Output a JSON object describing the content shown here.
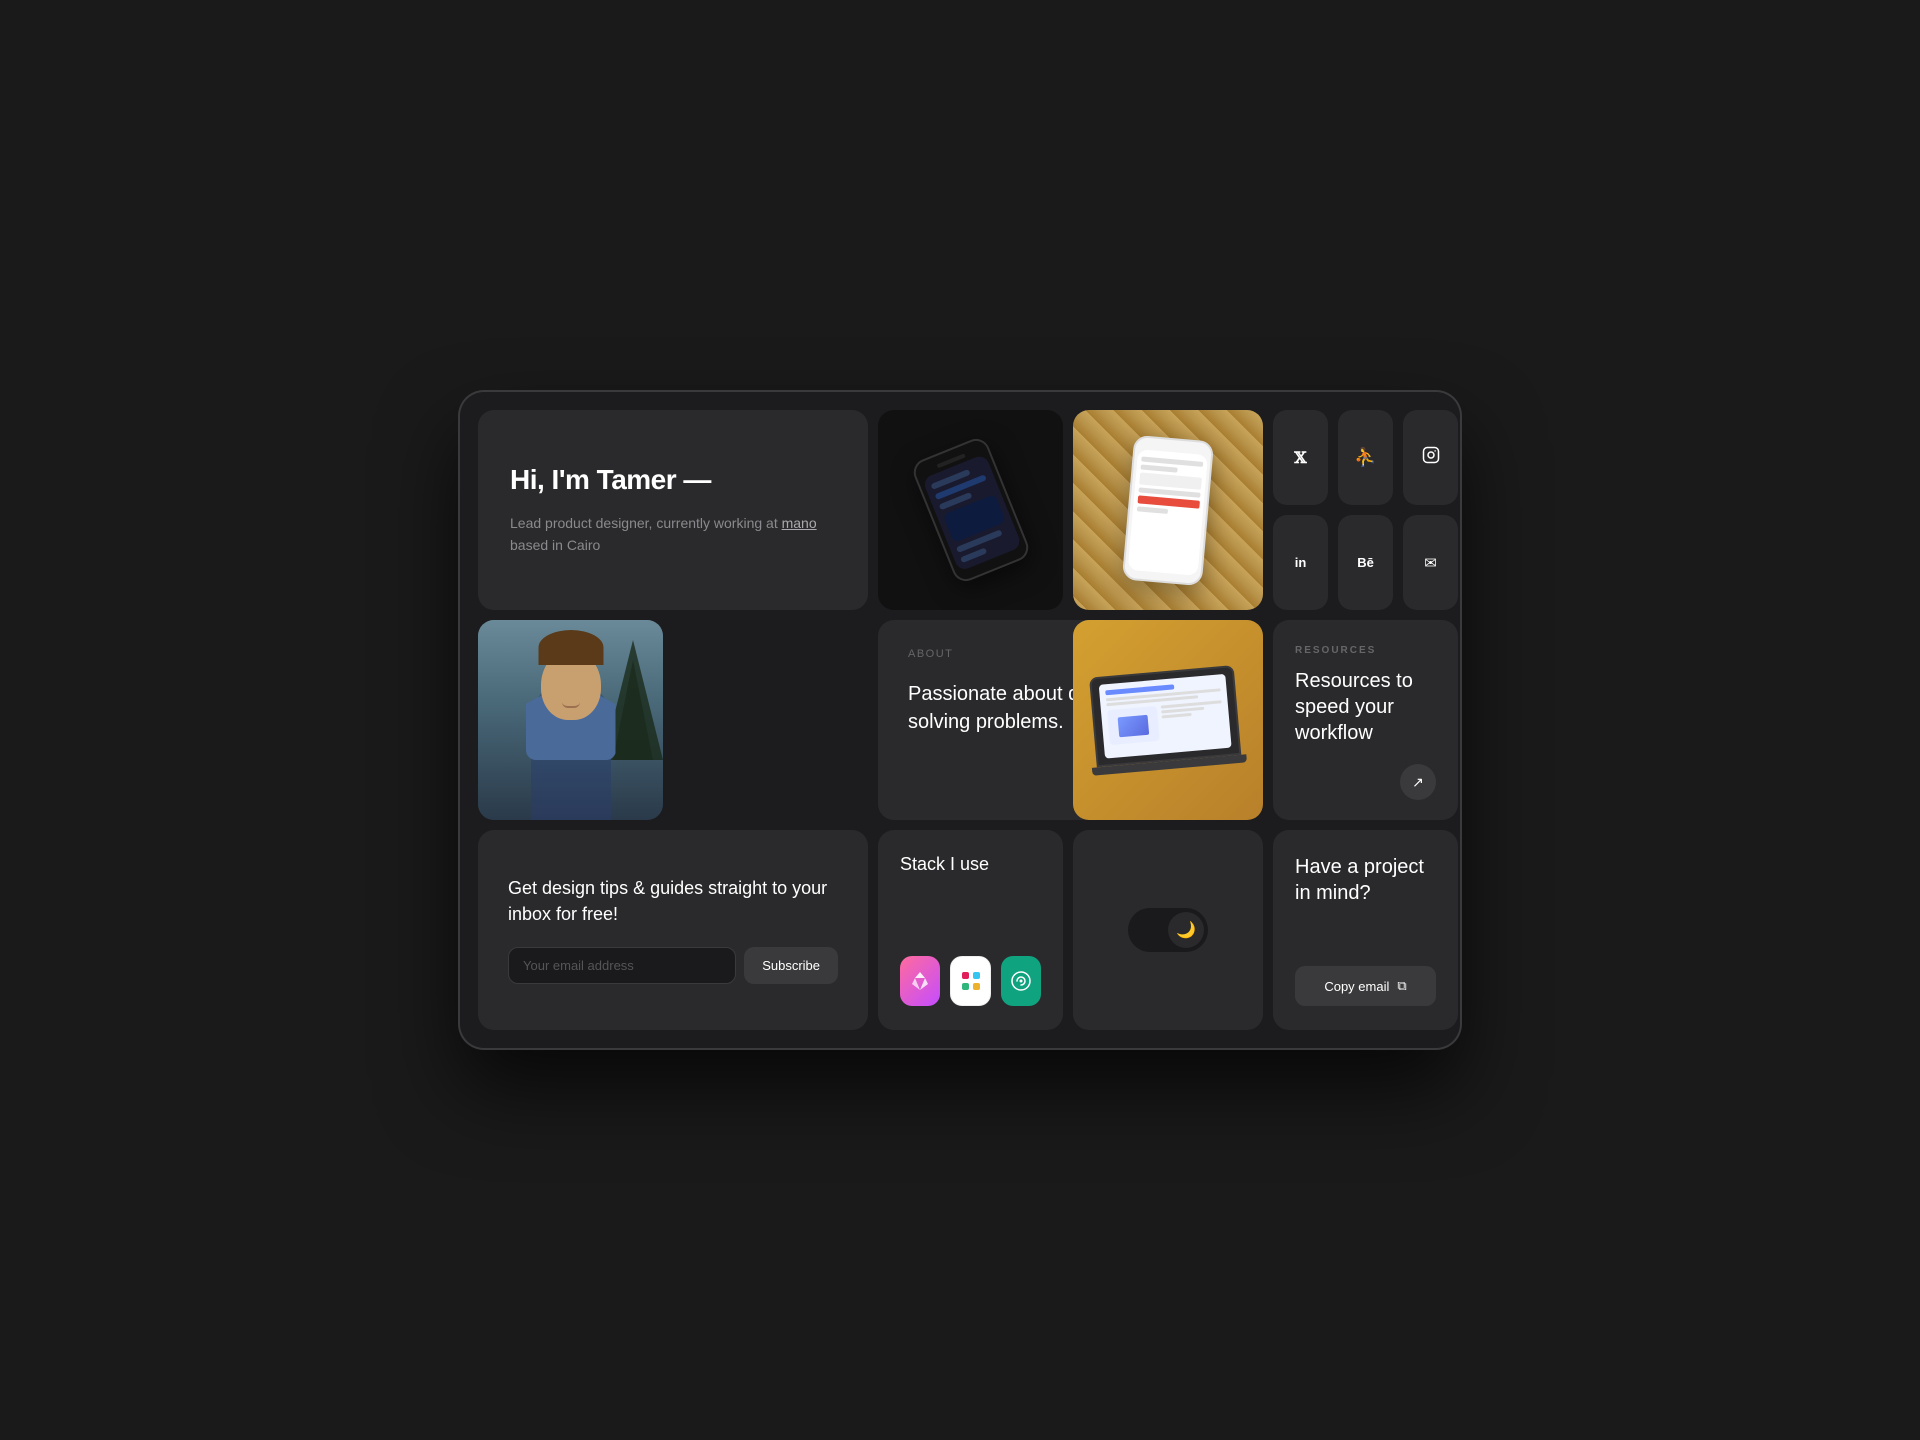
{
  "device": {
    "frame_bg": "#1c1c1e"
  },
  "hero": {
    "greeting": "Hi, I'm Tamer —",
    "description": "Lead product designer, currently working at mano based in Cairo",
    "underline_word": "mano"
  },
  "about": {
    "label": "ABOUT",
    "text": "Passionate about design and enjoy solving problems."
  },
  "resources": {
    "label": "RESOURCES",
    "title": "Resources to speed your workflow",
    "arrow": "↗"
  },
  "newsletter": {
    "title": "Get design tips & guides straight to your inbox for free!",
    "email_placeholder": "Your email address",
    "subscribe_label": "Subscribe"
  },
  "stack": {
    "title": "Stack I use",
    "apps": [
      {
        "name": "Craft",
        "emoji": "✦",
        "color_class": "app-craft"
      },
      {
        "name": "Slack",
        "emoji": "◈",
        "color_class": "app-slack"
      },
      {
        "name": "ChatGPT",
        "emoji": "◎",
        "color_class": "app-gpt"
      }
    ]
  },
  "toggle": {
    "mode": "dark",
    "icon": "🌙"
  },
  "project": {
    "title": "Have a project in mind?",
    "copy_email_label": "Copy email",
    "copy_icon": "⧉"
  },
  "socials": [
    {
      "name": "twitter",
      "icon": "𝕏",
      "label": "X / Twitter"
    },
    {
      "name": "dribbble",
      "icon": "⛹",
      "label": "Dribbble"
    },
    {
      "name": "instagram",
      "icon": "⬡",
      "label": "Instagram"
    },
    {
      "name": "linkedin",
      "icon": "in",
      "label": "LinkedIn"
    },
    {
      "name": "behance",
      "icon": "Bē",
      "label": "Behance"
    },
    {
      "name": "email",
      "icon": "✉",
      "label": "Email"
    }
  ]
}
